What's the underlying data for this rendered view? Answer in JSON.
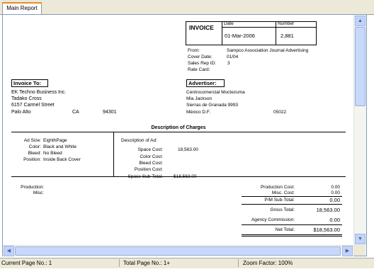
{
  "tab": {
    "label": "Main Report"
  },
  "invoice": {
    "title": "INVOICE",
    "date_label": "Date",
    "date": "01-Mar-2006",
    "number_label": "Number",
    "number": "2,881",
    "from_label": "From:",
    "from": "Sampco Association Journal Advertising",
    "cover_date_label": "Cover Date:",
    "cover_date": "01/04",
    "sales_rep_label": "Sales Rep ID:",
    "sales_rep": "3",
    "rate_card_label": "Rate Card:"
  },
  "invoice_to": {
    "heading": "Invoice To:",
    "company": "EK Techno Business Inc.",
    "contact": "Tadako Cross",
    "street": "6157 Carmel Street",
    "city": "Palo Alto",
    "state": "CA",
    "zip": "94301"
  },
  "advertiser": {
    "heading": "Advertiser:",
    "company": "Centrocomercial Moctezuma",
    "contact": "Mia Jackson",
    "street": "Sierras de Granada 9993",
    "city": "México D.F.",
    "zip": "05022"
  },
  "charges": {
    "heading": "Description of Charges",
    "ad_size_label": "Ad Size:",
    "ad_size": "EighthPage",
    "color_label": "Color:",
    "color": "Black and White",
    "bleed_label": "Bleed:",
    "bleed": "No Bleed",
    "position_label": "Position:",
    "position": "Inside Back Cover",
    "desc_ad_label": "Description of Ad:",
    "space_cost_label": "Space Cost:",
    "space_cost": "18,563.00",
    "color_cost_label": "Color Cost:",
    "bleed_cost_label": "Bleed Cost:",
    "position_cost_label": "Position Cost:",
    "space_subtotal_label": "Space Sub-Total:",
    "space_subtotal": "$18,563.00"
  },
  "totals": {
    "production_label": "Production:",
    "misc_label": "Misc:",
    "production_cost_label": "Production Cost:",
    "production_cost": "0.00",
    "misc_cost_label": "Misc. Cost:",
    "misc_cost": "0.00",
    "pm_subtotal_label": "P/M Sub-Total:",
    "pm_subtotal": "0.00",
    "gross_total_label": "Gross Total:",
    "gross_total": "18,563.00",
    "agency_commission_label": "Agency Commission:",
    "agency_commission": "0.00",
    "net_total_label": "Net Total:",
    "net_total": "$18,563.00"
  },
  "status": {
    "current_page": "Current Page No.: 1",
    "total_page": "Total Page No.: 1+",
    "zoom": "Zoom Factor: 100%"
  },
  "colors": {
    "tab_accent": "#e68b2c",
    "scrollbar": "#c1d3fb",
    "chrome": "#ece9d8"
  }
}
